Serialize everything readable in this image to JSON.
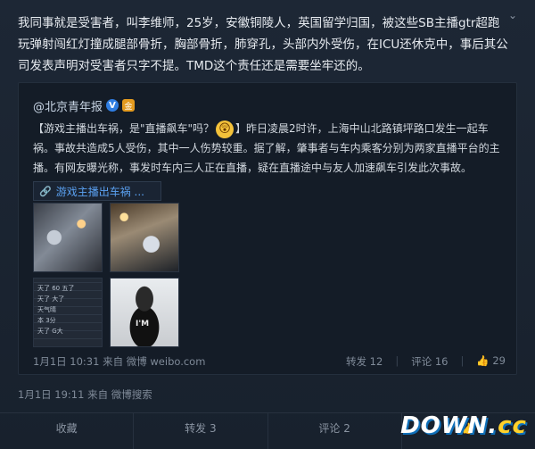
{
  "post": {
    "collapse_icon": "chevron-down-icon",
    "text": "我同事就是受害者，叫李维师，25岁，安徽铜陵人，英国留学归国，被这些SB主播gtr超跑玩弹射闯红灯撞成腿部骨折，胸部骨折，肺穿孔，头部内外受伤，在ICU还休克中，事后其公司发表声明对受害者只字不提。TMD这个责任还是需要坐牢还的。",
    "meta": "1月1日 19:11 来自 微博搜索"
  },
  "repost": {
    "author": "@北京青年报",
    "verified_badge": "V",
    "gold_badge": "金",
    "text_before_emoji": "【游戏主播出车祸，是\"直播飙车\"吗？",
    "emoji": "😲",
    "text_after_emoji": "】昨日凌晨2时许，上海中山北路镇坪路口发生一起车祸。事故共造成5人受伤，其中一人伤势较重。据了解，肇事者与车内乘客分别为两家直播平台的主播。有网友曝光称，事发时车内三人正在直播，疑在直播途中与友人加速飙车引发此次事故。",
    "topic_link": "游戏主播出车祸 ...",
    "thumbnails": [
      {
        "name": "crash-photo-1"
      },
      {
        "name": "crash-photo-2"
      },
      {
        "name": "livestream-screenshot"
      },
      {
        "name": "streamer-portrait",
        "shirt_text": "I'M"
      }
    ],
    "livestream_lines": [
      "天了 60 五了",
      "天了 大了",
      "天气晴",
      "本 3分",
      "天了 G大"
    ],
    "time": "1月1日 10:31 来自 微博 weibo.com",
    "repost_count_label": "转发 12",
    "comment_count_label": "评论 16",
    "like_count": "29"
  },
  "actions": {
    "favorite": "收藏",
    "repost": "转发 3",
    "comment": "评论 2",
    "like": ""
  },
  "watermark": {
    "text_main": "DOWN.",
    "text_tail": "cc"
  },
  "colors": {
    "background": "#1a2330",
    "link": "#5aa0f0",
    "verified": "#2f7de1"
  }
}
